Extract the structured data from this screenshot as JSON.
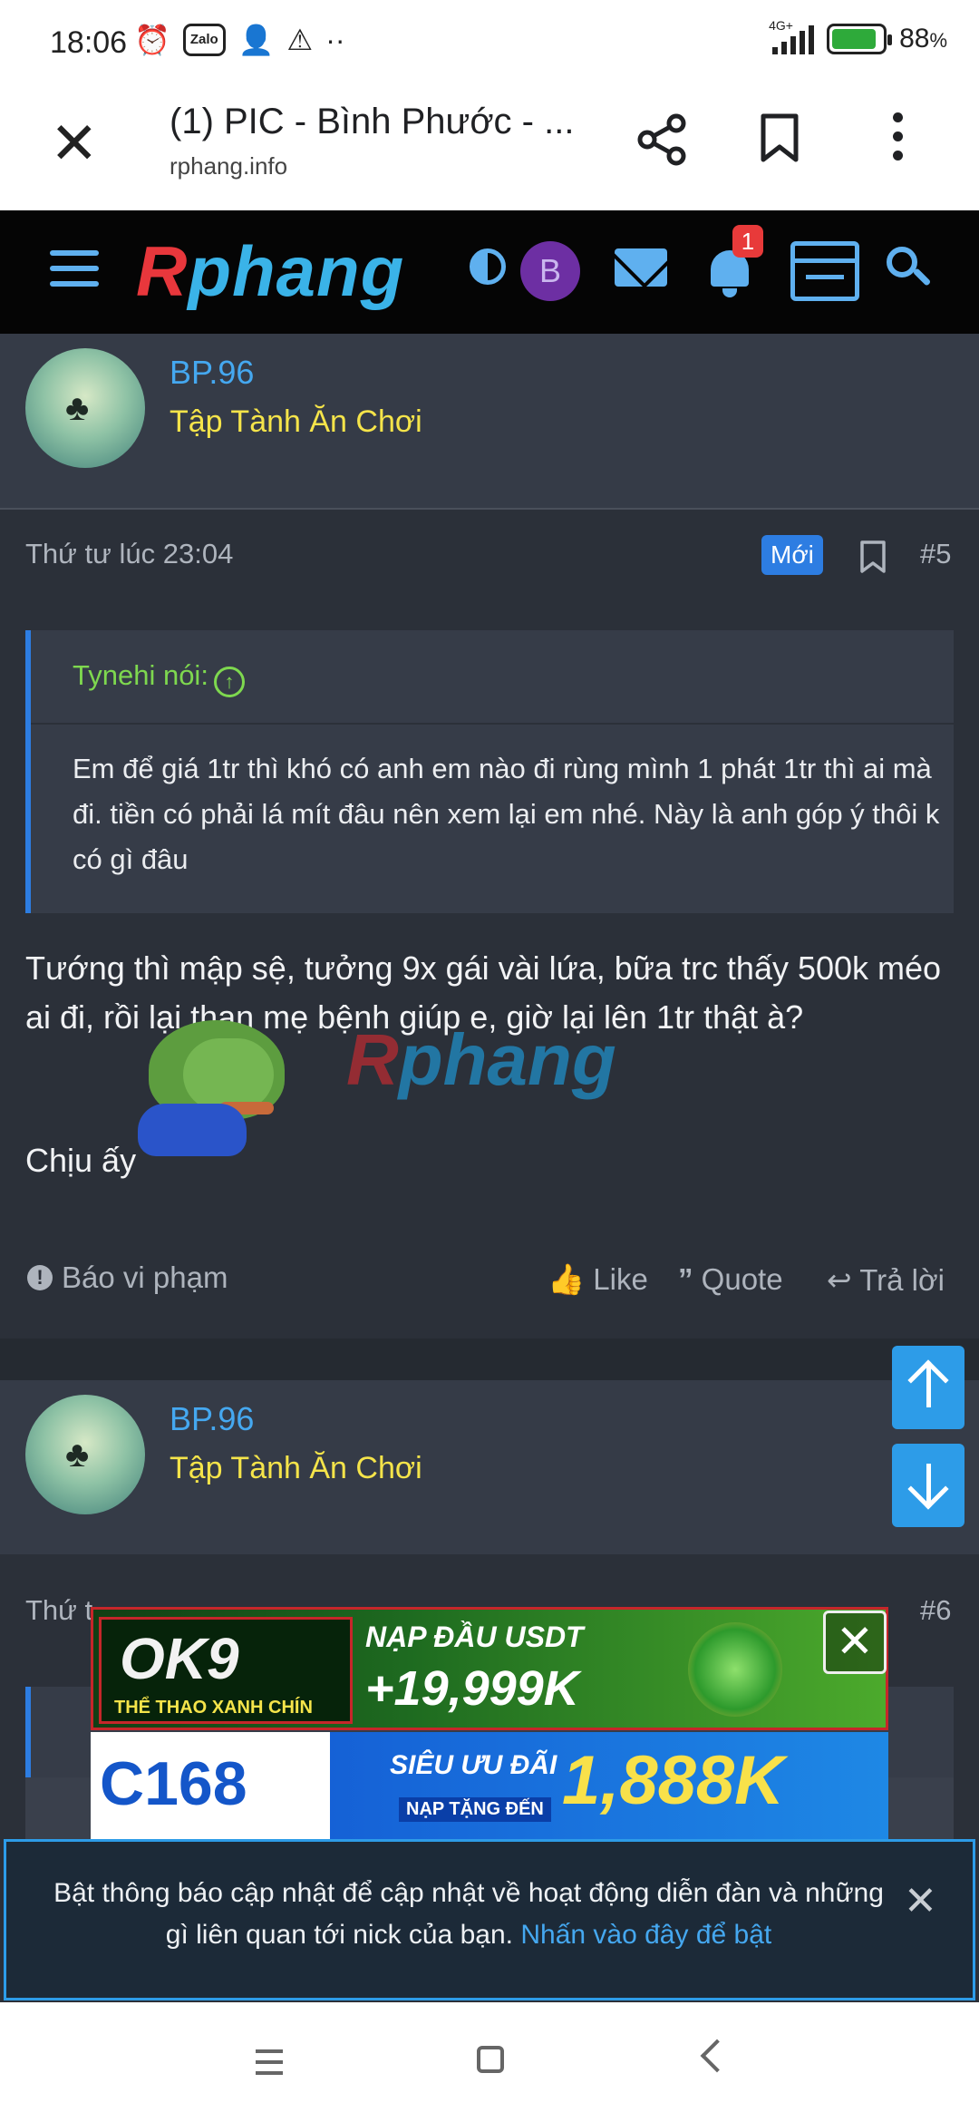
{
  "status_bar": {
    "time": "18:06",
    "network": "4G+",
    "battery": "88",
    "battery_unit": "%",
    "battery_level": 0.88
  },
  "browser": {
    "title": "(1) PIC - Bình Phước - ...",
    "url": "rphang.info"
  },
  "site": {
    "logo_r": "R",
    "logo_rest": "phang",
    "avatar_letter": "B",
    "notification_count": "1"
  },
  "post1": {
    "username": "BP.96",
    "user_title": "Tập Tành Ăn Chơi",
    "date": "Thứ tư lúc 23:04",
    "badge": "Mới",
    "number": "#5",
    "quote_author": "Tynehi nói:",
    "quote_text": "Em để giá 1tr thì khó có anh em nào đi rùng mình 1 phát 1tr thì ai mà đi. tiền có phải lá mít đâu nên xem lại em nhé. Này là anh góp ý thôi k có gì đâu",
    "message": "Tướng thì mập sệ, tưởng 9x gái vài lứa, bữa trc thấy 500k méo ai đi, rồi lại than mẹ bệnh giúp e, giờ lại lên 1tr thật à?",
    "sign": "Chịu ấy",
    "watermark_r": "R",
    "watermark_rest": "phang"
  },
  "actions": {
    "report": "Báo vi phạm",
    "like": "Like",
    "quote": "Quote",
    "reply": "Trả lời"
  },
  "post2": {
    "username": "BP.96",
    "user_title": "Tập Tành Ăn Chơi",
    "date_partial": "Thứ t",
    "number": "#6"
  },
  "ad": {
    "brand1": "OK9",
    "brand1_sub": "THỂ THAO XANH CHÍN",
    "promo1": "NẠP ĐẦU USDT",
    "promo2": "+19,999K",
    "brand2": "C168",
    "promo3": "SIÊU ƯU ĐÃI",
    "promo4": "1,888K",
    "promo5": "NẠP TẶNG ĐẾN"
  },
  "notice": {
    "text": "Bật thông báo cập nhật để cập nhật về hoạt động diễn đàn và những gì liên quan tới nick của bạn. ",
    "link": "Nhấn vào đây để bật"
  },
  "colors": {
    "accent": "#2d9ce8",
    "username": "#45a8f0",
    "user_title": "#f5e44a",
    "quote_author": "#7ed84f",
    "badge_new": "#2d7de2"
  }
}
